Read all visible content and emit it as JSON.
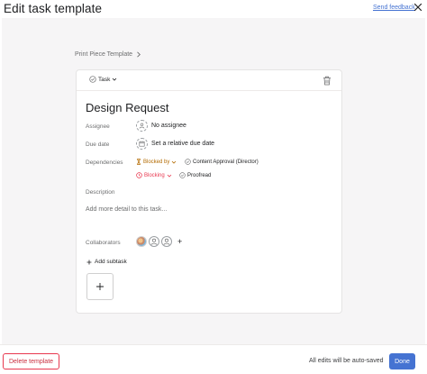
{
  "header": {
    "title": "Edit task template",
    "feedback_link": "Send feedback",
    "close_icon": "close-icon"
  },
  "breadcrumb": {
    "label": "Print Piece Template",
    "chevron_icon": "chevron-right-icon"
  },
  "card": {
    "type_label": "Task",
    "task_name": "Design Request",
    "fields": {
      "assignee_label": "Assignee",
      "assignee_value": "No assignee",
      "due_label": "Due date",
      "due_value": "Set a relative due date",
      "dependencies_label": "Dependencies",
      "blocked_by_label": "Blocked by",
      "blocked_by_task": "Content Approval (Director)",
      "blocking_label": "Blocking",
      "blocking_task": "Proofread",
      "description_label": "Description",
      "description_placeholder": "Add more detail to this task...",
      "collaborators_label": "Collaborators",
      "add_subtask_label": "Add subtask"
    }
  },
  "footer": {
    "delete_label": "Delete template",
    "autosave_text": "All edits will be auto-saved",
    "done_label": "Done"
  },
  "colors": {
    "accent": "#4573d2",
    "blocked_by": "#b36a00",
    "blocking": "#e8384f",
    "danger": "#c92f3f",
    "complete_check": "#6d6e6f"
  }
}
